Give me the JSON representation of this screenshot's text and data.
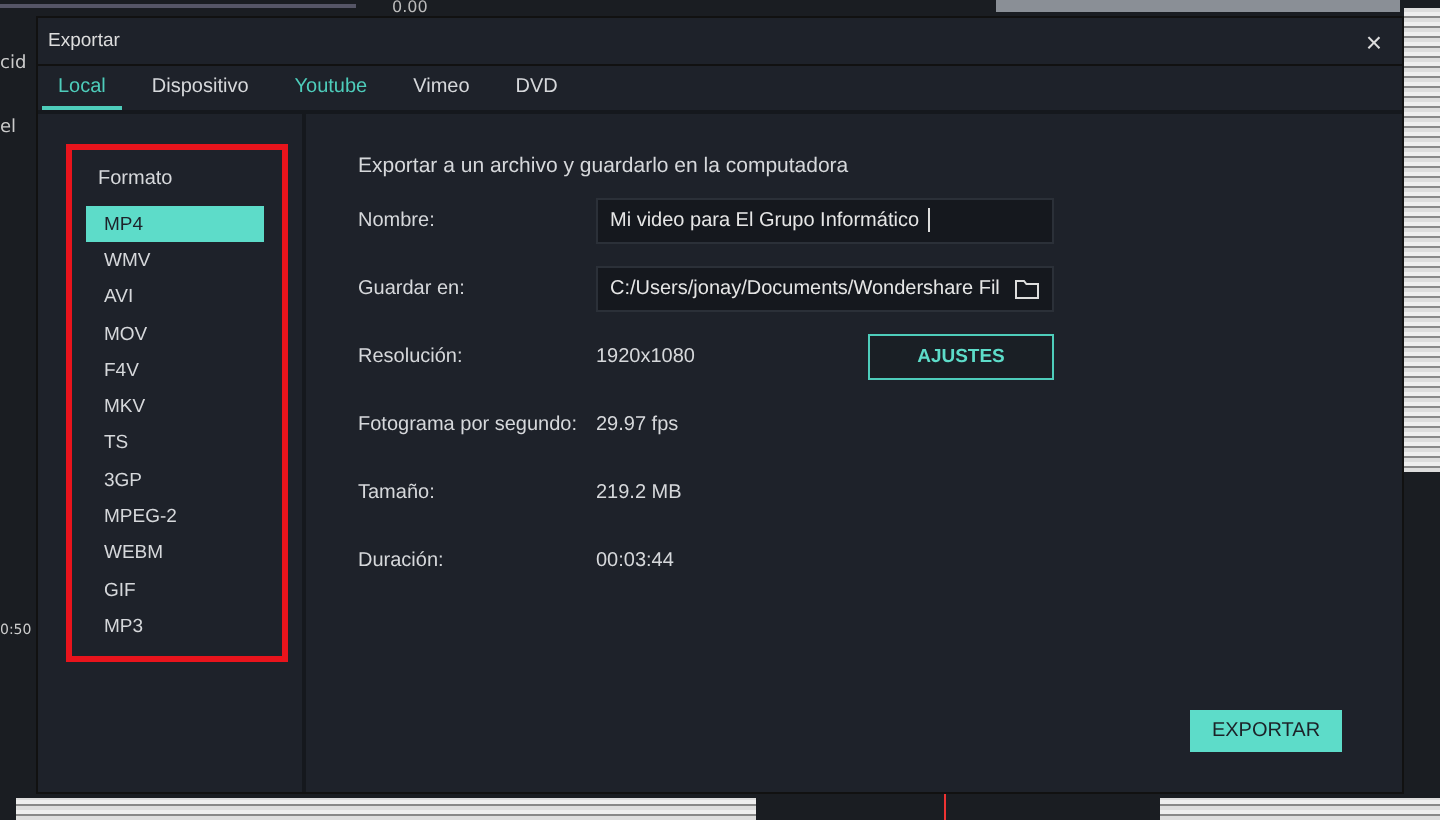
{
  "background_app": {
    "top_value": "0.00",
    "side_texts": [
      "cid",
      "el"
    ],
    "timecode": "0:50"
  },
  "window": {
    "title": "Exportar",
    "close": "×"
  },
  "tabs": [
    {
      "label": "Local",
      "selected": true,
      "hovered": false
    },
    {
      "label": "Dispositivo",
      "selected": false,
      "hovered": false
    },
    {
      "label": "Youtube",
      "selected": false,
      "hovered": true
    },
    {
      "label": "Vimeo",
      "selected": false,
      "hovered": false
    },
    {
      "label": "DVD",
      "selected": false,
      "hovered": false
    }
  ],
  "format_panel": {
    "title": "Formato",
    "highlighted": true,
    "items": [
      {
        "label": "MP4",
        "selected": true
      },
      {
        "label": "WMV",
        "selected": false
      },
      {
        "label": "AVI",
        "selected": false
      },
      {
        "label": "MOV",
        "selected": false
      },
      {
        "label": "F4V",
        "selected": false
      },
      {
        "label": "MKV",
        "selected": false
      },
      {
        "label": "TS",
        "selected": false
      },
      {
        "label": "3GP",
        "selected": false
      },
      {
        "label": "MPEG-2",
        "selected": false
      },
      {
        "label": "WEBM",
        "selected": false
      },
      {
        "label": "GIF",
        "selected": false
      },
      {
        "label": "MP3",
        "selected": false
      }
    ]
  },
  "heading": "Exportar a un archivo y guardarlo en la computadora",
  "fields": [
    {
      "kind": "input",
      "label": "Nombre:",
      "value": "Mi video para El Grupo Informático"
    },
    {
      "kind": "path",
      "label": "Guardar en:",
      "value": "C:/Users/jonay/Documents/Wondershare Fil"
    },
    {
      "kind": "button",
      "label": "Resolución:",
      "value": "1920x1080",
      "button": "AJUSTES"
    },
    {
      "kind": "text",
      "label": "Fotograma por segundo:",
      "value": "29.97 fps"
    },
    {
      "kind": "text",
      "label": "Tamaño:",
      "value": "219.2 MB"
    },
    {
      "kind": "text",
      "label": "Duración:",
      "value": "00:03:44"
    }
  ],
  "export_button": "EXPORTAR"
}
